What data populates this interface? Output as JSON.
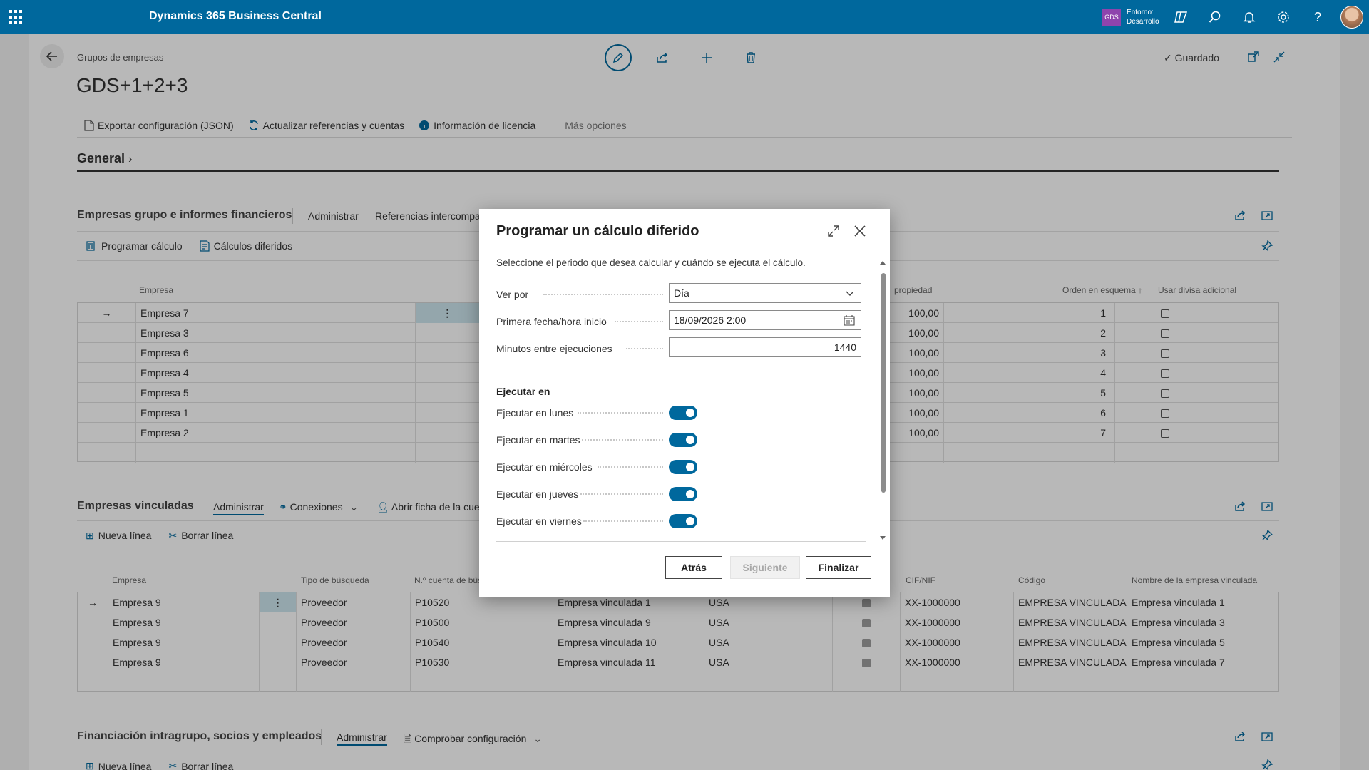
{
  "appbar": {
    "title": "Dynamics 365 Business Central",
    "env_badge": "GDS",
    "env_line1": "Entorno:",
    "env_line2": "Desarrollo",
    "icons": [
      "copilot-icon",
      "search-icon",
      "bell-icon",
      "gear-icon",
      "help-icon"
    ]
  },
  "header": {
    "breadcrumb": "Grupos de empresas",
    "title": "GDS+1+2+3",
    "saved": "Guardado"
  },
  "actions": {
    "export": "Exportar configuración (JSON)",
    "refresh": "Actualizar referencias y cuentas",
    "license": "Información de licencia",
    "more": "Más opciones"
  },
  "general": {
    "label": "General"
  },
  "part1": {
    "title": "Empresas grupo e informes financieros",
    "tabs": [
      "Administrar",
      "Referencias intercompa"
    ],
    "actions": [
      "Programar cálculo",
      "Cálculos diferidos"
    ],
    "headers": {
      "empresa": "Empresa",
      "propiedad": "propiedad",
      "orden": "Orden en esquema ↑",
      "divisa": "Usar divisa adicional"
    },
    "rows": [
      {
        "empresa": "Empresa 7",
        "propiedad": "100,00",
        "orden": "1"
      },
      {
        "empresa": "Empresa 3",
        "propiedad": "100,00",
        "orden": "2"
      },
      {
        "empresa": "Empresa 6",
        "propiedad": "100,00",
        "orden": "3"
      },
      {
        "empresa": "Empresa 4",
        "propiedad": "100,00",
        "orden": "4"
      },
      {
        "empresa": "Empresa 5",
        "propiedad": "100,00",
        "orden": "5"
      },
      {
        "empresa": "Empresa 1",
        "propiedad": "100,00",
        "orden": "6"
      },
      {
        "empresa": "Empresa 2",
        "propiedad": "100,00",
        "orden": "7"
      }
    ]
  },
  "part2": {
    "title": "Empresas vinculadas",
    "tabs": [
      "Administrar",
      "Conexiones",
      "Abrir ficha de la cue"
    ],
    "actions": [
      "Nueva línea",
      "Borrar línea"
    ],
    "headers": {
      "empresa": "Empresa",
      "tipo": "Tipo de búsqueda",
      "cuenta": "N.º cuenta de bús",
      "cif": "CIF/NIF",
      "codigo": "Código",
      "nombre": "Nombre de la empresa vinculada"
    },
    "rows": [
      {
        "empresa": "Empresa 9",
        "tipo": "Proveedor",
        "cuenta": "P10520",
        "vinculada": "Empresa vinculada 1",
        "pais": "USA",
        "cif": "XX-1000000",
        "codigo": "EMPRESA VINCULADA...",
        "nombre": "Empresa vinculada 1"
      },
      {
        "empresa": "Empresa 9",
        "tipo": "Proveedor",
        "cuenta": "P10500",
        "vinculada": "Empresa vinculada 9",
        "pais": "USA",
        "cif": "XX-1000000",
        "codigo": "EMPRESA VINCULADA...",
        "nombre": "Empresa vinculada 3"
      },
      {
        "empresa": "Empresa 9",
        "tipo": "Proveedor",
        "cuenta": "P10540",
        "vinculada": "Empresa vinculada 10",
        "pais": "USA",
        "cif": "XX-1000000",
        "codigo": "EMPRESA VINCULADA...",
        "nombre": "Empresa vinculada 5"
      },
      {
        "empresa": "Empresa 9",
        "tipo": "Proveedor",
        "cuenta": "P10530",
        "vinculada": "Empresa vinculada 11",
        "pais": "USA",
        "cif": "XX-1000000",
        "codigo": "EMPRESA VINCULADA...",
        "nombre": "Empresa vinculada 7"
      }
    ]
  },
  "part3": {
    "title": "Financiación intragrupo, socios y empleados",
    "tabs": [
      "Administrar",
      "Comprobar configuración"
    ],
    "actions": [
      "Nueva línea",
      "Borrar línea"
    ]
  },
  "dialog": {
    "title": "Programar un cálculo diferido",
    "description": "Seleccione el periodo que desea calcular y cuándo se ejecuta el cálculo.",
    "ver_por_label": "Ver por",
    "ver_por_value": "Día",
    "fecha_label": "Primera fecha/hora inicio",
    "fecha_value": "18/09/2026 2:00",
    "minutos_label": "Minutos entre ejecuciones",
    "minutos_value": "1440",
    "section": "Ejecutar en",
    "toggles": [
      {
        "label": "Ejecutar en lunes",
        "on": true
      },
      {
        "label": "Ejecutar en martes",
        "on": true
      },
      {
        "label": "Ejecutar en miércoles",
        "on": true
      },
      {
        "label": "Ejecutar en jueves",
        "on": true
      },
      {
        "label": "Ejecutar en viernes",
        "on": true
      }
    ],
    "buttons": {
      "back": "Atrás",
      "next": "Siguiente",
      "finish": "Finalizar"
    }
  },
  "colors": {
    "brand": "#00689d",
    "badge": "#8e44ad"
  }
}
